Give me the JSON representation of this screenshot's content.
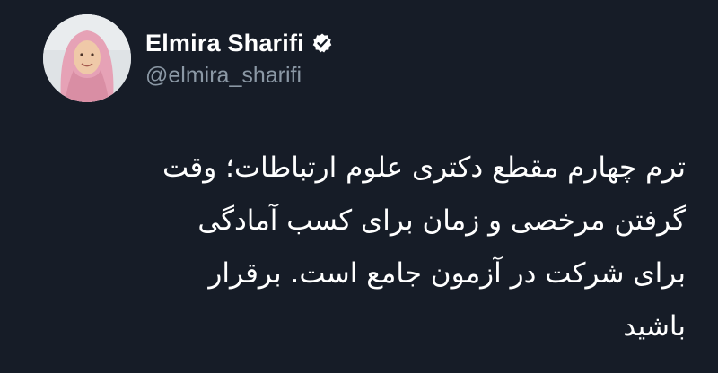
{
  "author": {
    "display_name": "Elmira Sharifi",
    "handle": "@elmira_sharifi",
    "verified": true
  },
  "icons": {
    "verified": "verified-badge-icon",
    "avatar": "profile-photo"
  },
  "tweet": {
    "lines": [
      "ترم چهارم مقطع دکتری علوم ارتباطات؛ وقت",
      "گرفتن مرخصی و زمان برای کسب آمادگی",
      "برای شرکت در آزمون جامع است. برقرار",
      "باشید"
    ]
  },
  "colors": {
    "background": "#161c27",
    "text_primary": "#ffffff",
    "text_secondary": "#8b98a5",
    "badge": "#ffffff"
  }
}
